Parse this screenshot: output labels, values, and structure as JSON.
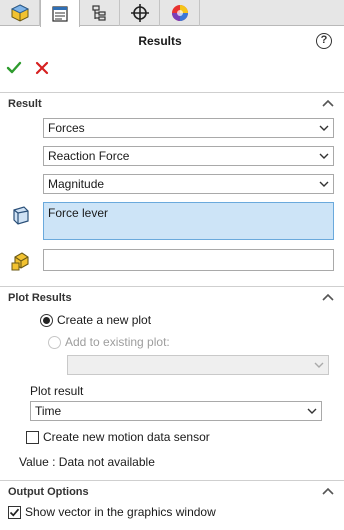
{
  "tabs": [
    {
      "name": "featuremanager-tab",
      "icon": "part-cube-icon"
    },
    {
      "name": "propertymanager-tab",
      "icon": "property-list-icon"
    },
    {
      "name": "configuration-manager-tab",
      "icon": "configuration-icon"
    },
    {
      "name": "dimxpert-tab",
      "icon": "crosshair-icon"
    },
    {
      "name": "display-manager-tab",
      "icon": "color-sphere-icon"
    }
  ],
  "panel": {
    "title": "Results",
    "help_icon": "?"
  },
  "result_section": {
    "header": "Result",
    "dropdown1": "Forces",
    "dropdown2": "Reaction Force",
    "dropdown3": "Magnitude",
    "selection_value": "Force lever",
    "second_input_value": ""
  },
  "plot_section": {
    "header": "Plot Results",
    "create_new_label": "Create a new plot",
    "add_existing_label": "Add to existing plot:",
    "existing_plot_value": "",
    "plot_result_label": "Plot result",
    "plot_result_value": "Time",
    "sensor_label": "Create new motion data sensor",
    "value_text": "Value : Data not available"
  },
  "output_section": {
    "header": "Output Options",
    "show_vector_label": "Show vector in the graphics window"
  },
  "colors": {
    "accent_blue": "#cde4f7",
    "ok_green": "#2e9b2e",
    "cancel_red": "#d62020"
  }
}
